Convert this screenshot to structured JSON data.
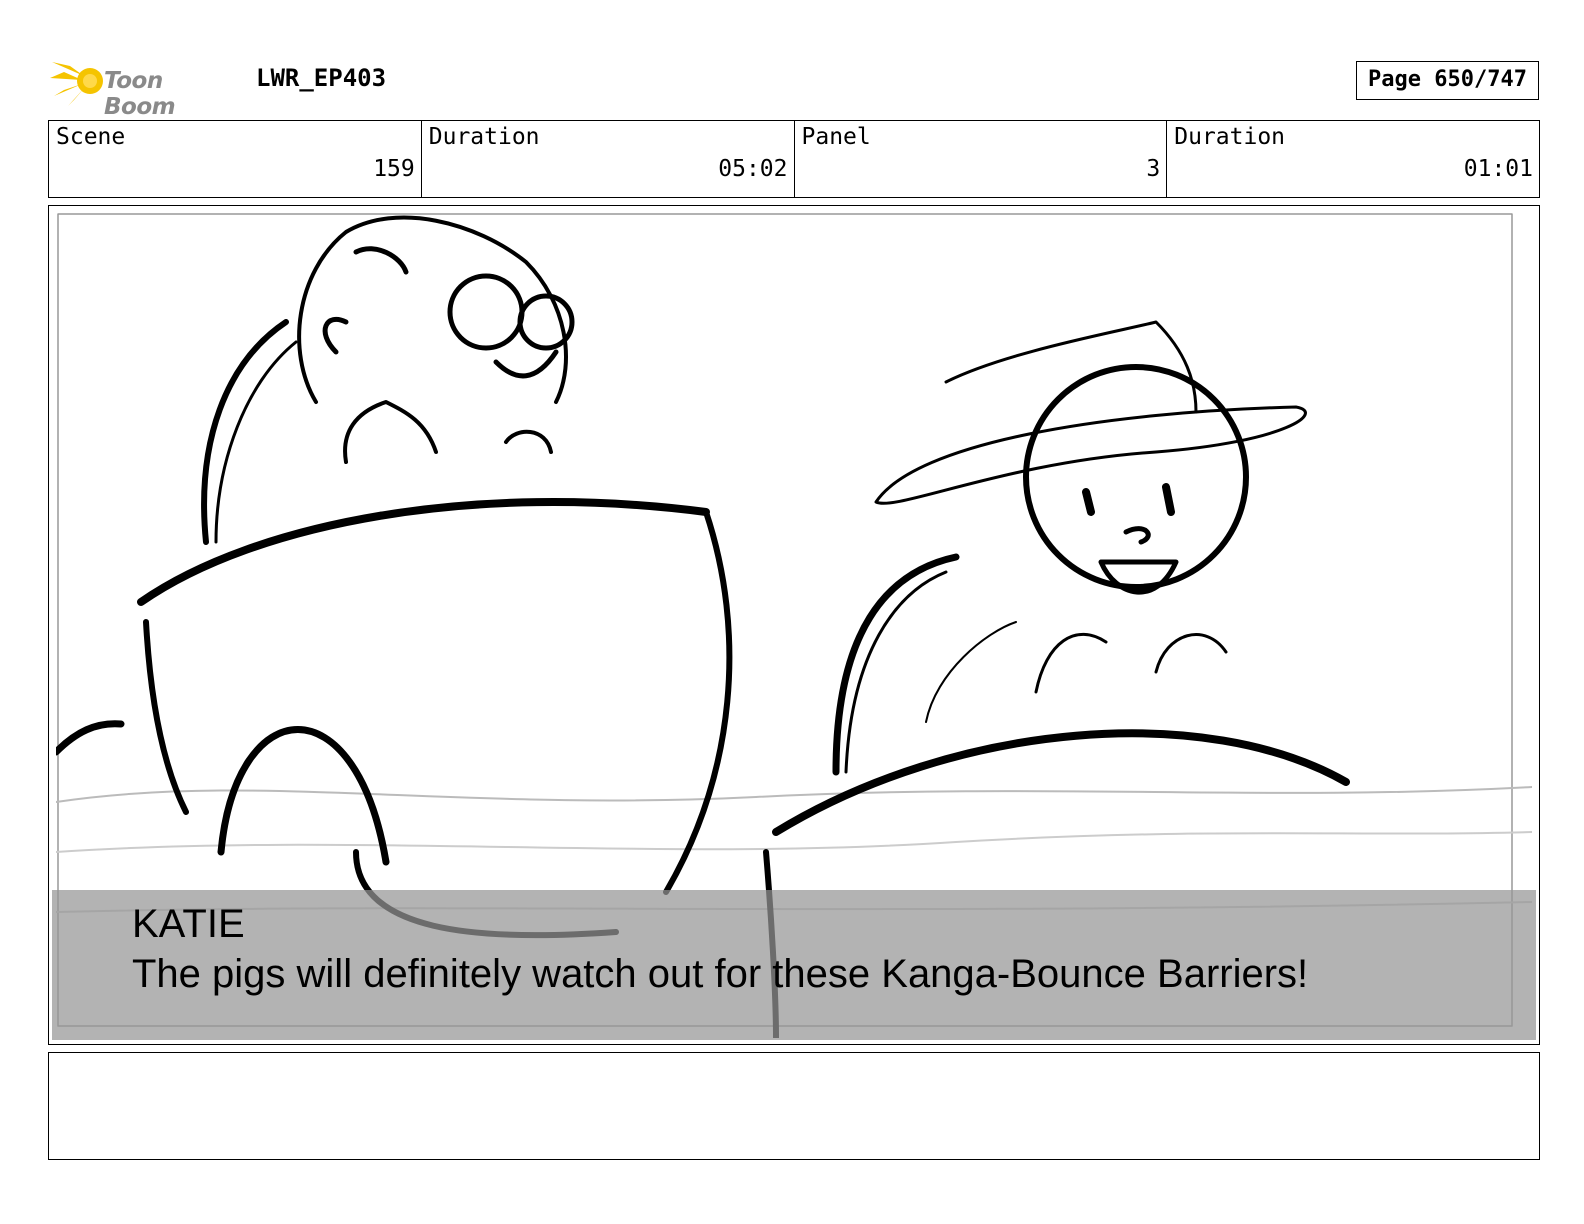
{
  "header": {
    "logo_text": "Toon Boom",
    "project": "LWR_EP403",
    "page": "Page 650/747"
  },
  "info": {
    "scene_label": "Scene",
    "scene_value": "159",
    "scene_duration_label": "Duration",
    "scene_duration_value": "05:02",
    "panel_label": "Panel",
    "panel_value": "3",
    "panel_duration_label": "Duration",
    "panel_duration_value": "01:01"
  },
  "caption": {
    "character": "KATIE",
    "dialogue": "The pigs will definitely watch out for these Kanga-Bounce Barriers!"
  },
  "colors": {
    "logo_star": "#f5c400",
    "logo_text": "#8a8a8a",
    "caption_bg": "#969696"
  }
}
